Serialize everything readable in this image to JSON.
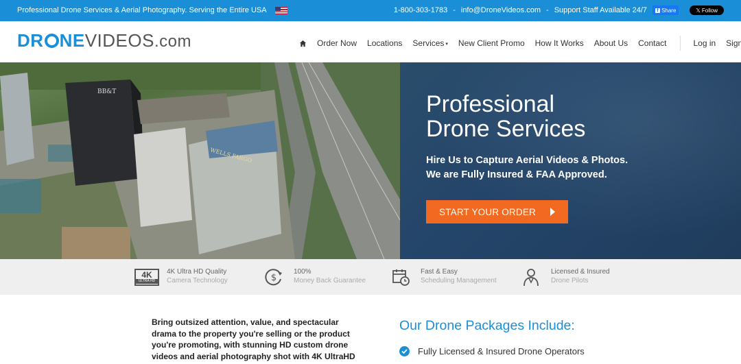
{
  "topbar": {
    "tagline": "Professional Drone Services & Aerial Photography. Serving the Entire USA",
    "phone": "1-800-303-1783",
    "email": "info@DroneVideos.com",
    "support": "Support Staff Available 24/7",
    "share_label": "Share",
    "follow_label": "Follow",
    "separator": "-"
  },
  "logo": {
    "part1": "DR",
    "part2": "NE",
    "part3": "VIDEOS",
    "part4": ".com"
  },
  "nav": {
    "items": [
      "Order Now",
      "Locations",
      "Services",
      "New Client Promo",
      "How It Works",
      "About Us",
      "Contact"
    ],
    "login": "Log in",
    "signup": "Sign up"
  },
  "hero": {
    "title_line1": "Professional",
    "title_line2": "Drone Services",
    "sub_line1": "Hire Us to Capture Aerial Videos & Photos.",
    "sub_line2": "We are Fully Insured & FAA Approved.",
    "cta_label": "START YOUR ORDER",
    "building_label_1": "BB&T",
    "building_label_2": "WELLS FARGO"
  },
  "features": [
    {
      "line1": "4K Ultra HD Quality",
      "line2": "Camera Technology",
      "icon": "4k-badge-icon",
      "badge_main": "4K",
      "badge_sub": "ULTRA HD"
    },
    {
      "line1": "100%",
      "line2": "Money Back Guarantee",
      "icon": "dollar-refund-icon"
    },
    {
      "line1": "Fast & Easy",
      "line2": "Scheduling Management",
      "icon": "calendar-clock-icon"
    },
    {
      "line1": "Licensed & Insured",
      "line2": "Drone Pilots",
      "icon": "pilot-icon"
    }
  ],
  "content": {
    "intro": "Bring outsized attention, value, and spectacular drama to the property you're selling or the product you're promoting, with stunning HD custom drone videos and aerial photography shot with 4K UltraHD",
    "packages_title": "Our Drone Packages Include:",
    "package_items": [
      "Fully Licensed & Insured Drone Operators"
    ]
  },
  "colors": {
    "brand_blue": "#1a8fd8",
    "cta_orange": "#f26a21",
    "hero_navy": "#24456a"
  }
}
